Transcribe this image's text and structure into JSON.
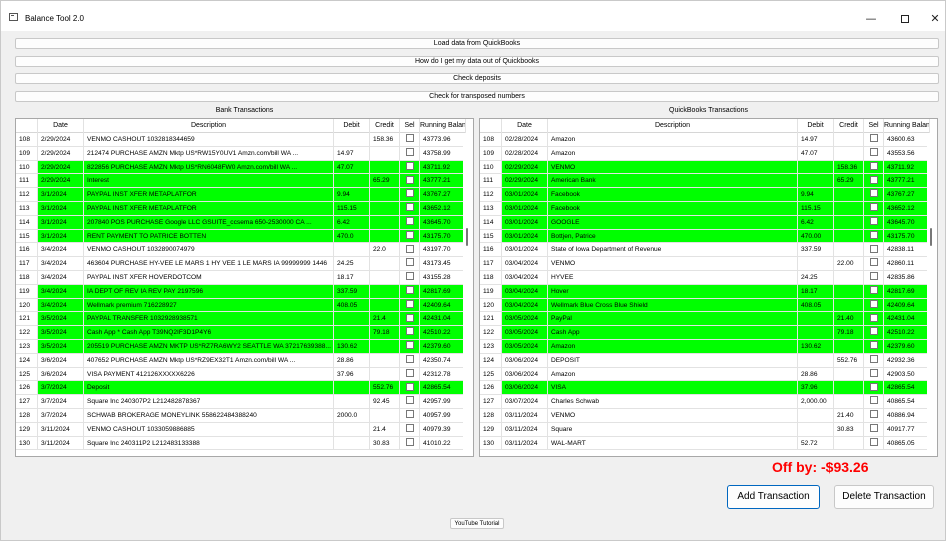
{
  "window": {
    "title": "Balance Tool 2.0",
    "minimize_glyph": "—",
    "close_glyph": "✕"
  },
  "buttons": {
    "load": "Load data from QuickBooks",
    "howto": "How do I get my data out of Quickbooks",
    "deposits": "Check deposits",
    "transposed": "Check for transposed numbers",
    "add": "Add Transaction",
    "delete": "Delete Transaction",
    "youtube": "YouTube Tutorial"
  },
  "offby": "Off by: -$93.26",
  "colors": {
    "match": "#00ff00",
    "offby": "#ff0000"
  },
  "bank": {
    "title": "Bank Transactions",
    "columns": [
      "",
      "Date",
      "Description",
      "Debit",
      "Credit",
      "Sel",
      "Running Balance"
    ],
    "rows": [
      {
        "idx": "108",
        "date": "2/29/2024",
        "desc": "VENMO CASHOUT 1032818344659",
        "debit": "",
        "credit": "158.36",
        "bal": "43773.96",
        "g": false
      },
      {
        "idx": "109",
        "date": "2/29/2024",
        "desc": "212474 PURCHASE AMZN Mktp US*RW15Y0UV1 Amzn.com/bill WA ...",
        "debit": "14.97",
        "credit": "",
        "bal": "43758.99",
        "g": false
      },
      {
        "idx": "110",
        "date": "2/29/2024",
        "desc": "822856 PURCHASE AMZN Mktp US*RN6048FW0 Amzn.com/bill WA ...",
        "debit": "47.07",
        "credit": "",
        "bal": "43711.92",
        "g": true
      },
      {
        "idx": "111",
        "date": "2/29/2024",
        "desc": "Interest",
        "debit": "",
        "credit": "65.29",
        "bal": "43777.21",
        "g": true
      },
      {
        "idx": "112",
        "date": "3/1/2024",
        "desc": "PAYPAL INST XFER METAPLATFOR",
        "debit": "9.94",
        "credit": "",
        "bal": "43767.27",
        "g": true
      },
      {
        "idx": "113",
        "date": "3/1/2024",
        "desc": "PAYPAL INST XFER METAPLATFOR",
        "debit": "115.15",
        "credit": "",
        "bal": "43652.12",
        "g": true
      },
      {
        "idx": "114",
        "date": "3/1/2024",
        "desc": "207840 POS PURCHASE Google LLC GSUITE_ccsema 650-2530000 CA ...",
        "debit": "6.42",
        "credit": "",
        "bal": "43645.70",
        "g": true
      },
      {
        "idx": "115",
        "date": "3/1/2024",
        "desc": "RENT PAYMENT TO PATRICE BOTTEN",
        "debit": "470.0",
        "credit": "",
        "bal": "43175.70",
        "g": true
      },
      {
        "idx": "116",
        "date": "3/4/2024",
        "desc": "VENMO CASHOUT 1032890074979",
        "debit": "",
        "credit": "22.0",
        "bal": "43197.70",
        "g": false
      },
      {
        "idx": "117",
        "date": "3/4/2024",
        "desc": "463604 PURCHASE HY-VEE LE MARS 1 HY VEE 1 LE MARS IA 99999999 1446",
        "debit": "24.25",
        "credit": "",
        "bal": "43173.45",
        "g": false
      },
      {
        "idx": "118",
        "date": "3/4/2024",
        "desc": "PAYPAL INST XFER HOVERDOTCOM",
        "debit": "18.17",
        "credit": "",
        "bal": "43155.28",
        "g": false
      },
      {
        "idx": "119",
        "date": "3/4/2024",
        "desc": "IA DEPT OF REV IA REV PAY 2197596",
        "debit": "337.59",
        "credit": "",
        "bal": "42817.69",
        "g": true
      },
      {
        "idx": "120",
        "date": "3/4/2024",
        "desc": "Wellmark premium 716228927",
        "debit": "408.05",
        "credit": "",
        "bal": "42409.64",
        "g": true
      },
      {
        "idx": "121",
        "date": "3/5/2024",
        "desc": "PAYPAL TRANSFER 1032928938571",
        "debit": "",
        "credit": "21.4",
        "bal": "42431.04",
        "g": true
      },
      {
        "idx": "122",
        "date": "3/5/2024",
        "desc": "Cash App * Cash App T39NQ2IF3D1P4Y6",
        "debit": "",
        "credit": "79.18",
        "bal": "42510.22",
        "g": true
      },
      {
        "idx": "123",
        "date": "3/5/2024",
        "desc": "205519 PURCHASE AMZN MKTP US*RZ7RA6WY2 SEATTLE WA 37217639388...",
        "debit": "130.62",
        "credit": "",
        "bal": "42379.60",
        "g": true
      },
      {
        "idx": "124",
        "date": "3/6/2024",
        "desc": "407652 PURCHASE AMZN Mktp US*RZ9EX32T1 Amzn.com/bill WA ...",
        "debit": "28.86",
        "credit": "",
        "bal": "42350.74",
        "g": false
      },
      {
        "idx": "125",
        "date": "3/6/2024",
        "desc": "VISA PAYMENT 412126XXXXX6226",
        "debit": "37.96",
        "credit": "",
        "bal": "42312.78",
        "g": false
      },
      {
        "idx": "126",
        "date": "3/7/2024",
        "desc": "Deposit",
        "debit": "",
        "credit": "552.76",
        "bal": "42865.54",
        "g": true
      },
      {
        "idx": "127",
        "date": "3/7/2024",
        "desc": "Square Inc 240307P2 L212482878367",
        "debit": "",
        "credit": "92.45",
        "bal": "42957.99",
        "g": false
      },
      {
        "idx": "128",
        "date": "3/7/2024",
        "desc": "SCHWAB BROKERAGE MONEYLINK 558622484388240",
        "debit": "2000.0",
        "credit": "",
        "bal": "40957.99",
        "g": false
      },
      {
        "idx": "129",
        "date": "3/11/2024",
        "desc": "VENMO CASHOUT 1033059886885",
        "debit": "",
        "credit": "21.4",
        "bal": "40979.39",
        "g": false
      },
      {
        "idx": "130",
        "date": "3/11/2024",
        "desc": "Square Inc 240311P2 L212483133388",
        "debit": "",
        "credit": "30.83",
        "bal": "41010.22",
        "g": false
      }
    ]
  },
  "qb": {
    "title": "QuickBooks Transactions",
    "columns": [
      "",
      "Date",
      "Description",
      "Debit",
      "Credit",
      "Sel",
      "Running Balance"
    ],
    "rows": [
      {
        "idx": "108",
        "date": "02/28/2024",
        "desc": "Amazon",
        "debit": "14.97",
        "credit": "",
        "bal": "43600.63",
        "g": false
      },
      {
        "idx": "109",
        "date": "02/28/2024",
        "desc": "Amazon",
        "debit": "47.07",
        "credit": "",
        "bal": "43553.56",
        "g": false
      },
      {
        "idx": "110",
        "date": "02/29/2024",
        "desc": "VENMO",
        "debit": "",
        "credit": "158.36",
        "bal": "43711.92",
        "g": true
      },
      {
        "idx": "111",
        "date": "02/29/2024",
        "desc": "American Bank",
        "debit": "",
        "credit": "65.29",
        "bal": "43777.21",
        "g": true
      },
      {
        "idx": "112",
        "date": "03/01/2024",
        "desc": "Facebook",
        "debit": "9.94",
        "credit": "",
        "bal": "43767.27",
        "g": true
      },
      {
        "idx": "113",
        "date": "03/01/2024",
        "desc": "Facebook",
        "debit": "115.15",
        "credit": "",
        "bal": "43652.12",
        "g": true
      },
      {
        "idx": "114",
        "date": "03/01/2024",
        "desc": "GOOGLE",
        "debit": "6.42",
        "credit": "",
        "bal": "43645.70",
        "g": true
      },
      {
        "idx": "115",
        "date": "03/01/2024",
        "desc": "Bottjen, Patrice",
        "debit": "470.00",
        "credit": "",
        "bal": "43175.70",
        "g": true
      },
      {
        "idx": "116",
        "date": "03/01/2024",
        "desc": "State of Iowa Department of Revenue",
        "debit": "337.59",
        "credit": "",
        "bal": "42838.11",
        "g": false
      },
      {
        "idx": "117",
        "date": "03/04/2024",
        "desc": "VENMO",
        "debit": "",
        "credit": "22.00",
        "bal": "42860.11",
        "g": false
      },
      {
        "idx": "118",
        "date": "03/04/2024",
        "desc": "HYVEE",
        "debit": "24.25",
        "credit": "",
        "bal": "42835.86",
        "g": false
      },
      {
        "idx": "119",
        "date": "03/04/2024",
        "desc": "Hover",
        "debit": "18.17",
        "credit": "",
        "bal": "42817.69",
        "g": true
      },
      {
        "idx": "120",
        "date": "03/04/2024",
        "desc": "Wellmark Blue Cross Blue Shield",
        "debit": "408.05",
        "credit": "",
        "bal": "42409.64",
        "g": true
      },
      {
        "idx": "121",
        "date": "03/05/2024",
        "desc": "PayPal",
        "debit": "",
        "credit": "21.40",
        "bal": "42431.04",
        "g": true
      },
      {
        "idx": "122",
        "date": "03/05/2024",
        "desc": "Cash App",
        "debit": "",
        "credit": "79.18",
        "bal": "42510.22",
        "g": true
      },
      {
        "idx": "123",
        "date": "03/05/2024",
        "desc": "Amazon",
        "debit": "130.62",
        "credit": "",
        "bal": "42379.60",
        "g": true
      },
      {
        "idx": "124",
        "date": "03/06/2024",
        "desc": "DEPOSIT",
        "debit": "",
        "credit": "552.76",
        "bal": "42932.36",
        "g": false
      },
      {
        "idx": "125",
        "date": "03/06/2024",
        "desc": "Amazon",
        "debit": "28.86",
        "credit": "",
        "bal": "42903.50",
        "g": false
      },
      {
        "idx": "126",
        "date": "03/06/2024",
        "desc": "VISA",
        "debit": "37.96",
        "credit": "",
        "bal": "42865.54",
        "g": true
      },
      {
        "idx": "127",
        "date": "03/07/2024",
        "desc": "Charles Schwab",
        "debit": "2,000.00",
        "credit": "",
        "bal": "40865.54",
        "g": false
      },
      {
        "idx": "128",
        "date": "03/11/2024",
        "desc": "VENMO",
        "debit": "",
        "credit": "21.40",
        "bal": "40886.94",
        "g": false
      },
      {
        "idx": "129",
        "date": "03/11/2024",
        "desc": "Square",
        "debit": "",
        "credit": "30.83",
        "bal": "40917.77",
        "g": false
      },
      {
        "idx": "130",
        "date": "03/11/2024",
        "desc": "WAL-MART",
        "debit": "52.72",
        "credit": "",
        "bal": "40865.05",
        "g": false
      }
    ]
  }
}
